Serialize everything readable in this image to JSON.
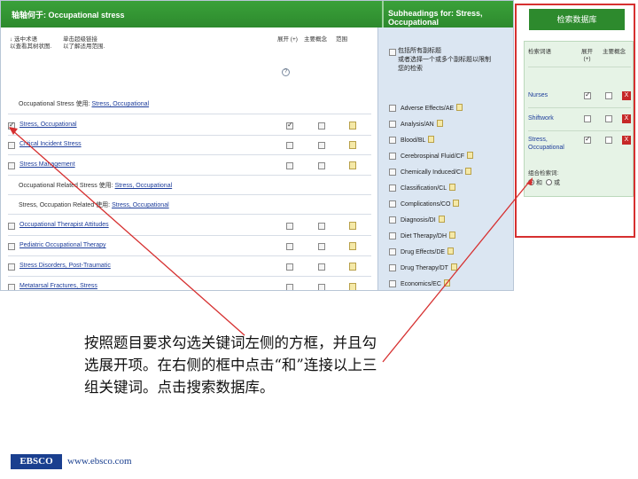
{
  "header": {
    "left_title": "轴轴何于: Occupational stress",
    "right_title": "Subheadings for: Stress, Occupational"
  },
  "columns": {
    "terms_help": "↓ 选中术语\n以查看其树状图.",
    "scope_help": "单击超级链接\n以了解适用范围.",
    "explode": "展开 (+)",
    "major_concept": "主要概念",
    "scope": "范围"
  },
  "question_mark": "?",
  "rows": [
    {
      "type": "see",
      "prefix": "Occupational Stress 使用:",
      "link": "Stress, Occupational"
    },
    {
      "type": "term",
      "label": "Stress, Occupational",
      "checked": true,
      "explode": true
    },
    {
      "type": "term",
      "label": "Critical Incident Stress",
      "checked": false,
      "explode": false
    },
    {
      "type": "term",
      "label": "Stress Management",
      "checked": false,
      "explode": false
    },
    {
      "type": "see",
      "prefix": "Occupational Related Stress 使用:",
      "link": "Stress, Occupational"
    },
    {
      "type": "see",
      "prefix": "Stress, Occupation Related 使用:",
      "link": "Stress, Occupational"
    },
    {
      "type": "term",
      "label": "Occupational Therapist Attitudes",
      "checked": false,
      "explode": false
    },
    {
      "type": "term",
      "label": "Pediatric Occupational Therapy",
      "checked": false,
      "explode": false
    },
    {
      "type": "term",
      "label": "Stress Disorders, Post-Traumatic",
      "checked": false,
      "explode": false
    },
    {
      "type": "term",
      "label": "Metatarsal Fractures, Stress",
      "checked": false,
      "explode": false
    }
  ],
  "subheadings": {
    "include_all": "包括所有副标题\n或者选择一个或多个副标题以限制\n您的检索",
    "items": [
      "Adverse Effects/AE",
      "Analysis/AN",
      "Blood/BL",
      "Cerebrospinal Fluid/CF",
      "Chemically Induced/CI",
      "Classification/CL",
      "Complications/CO",
      "Diagnosis/DI",
      "Diet Therapy/DH",
      "Drug Effects/DE",
      "Drug Therapy/DT",
      "Economics/EC"
    ]
  },
  "search_box": {
    "button": "检索数据库",
    "col_term": "检索词语",
    "col_explode": "展开\n(+)",
    "col_major": "主要概念",
    "rows": [
      {
        "term": "Nurses",
        "explode": true,
        "major": false,
        "remove": "X"
      },
      {
        "term": "Shiftwork",
        "explode": false,
        "major": false,
        "remove": "X"
      },
      {
        "term": "Stress,\nOccupational",
        "explode": true,
        "major": false,
        "remove": "X"
      }
    ],
    "combine_label": "组合检索词:",
    "and_label": "和",
    "or_label": "或"
  },
  "instruction": "按照题目要求勾选关键词左侧的方框，并且勾选展开项。在右侧的框中点击“和”连接以上三组关键词。点击搜索数据库。",
  "footer": {
    "logo": "EBSCO",
    "website": "www.ebsco.com"
  },
  "colors": {
    "header_green": "#2d8a2d",
    "link_blue": "#1d3d9b",
    "subpanel_blue": "#dbe6f2",
    "highlight_red": "#d63030"
  }
}
